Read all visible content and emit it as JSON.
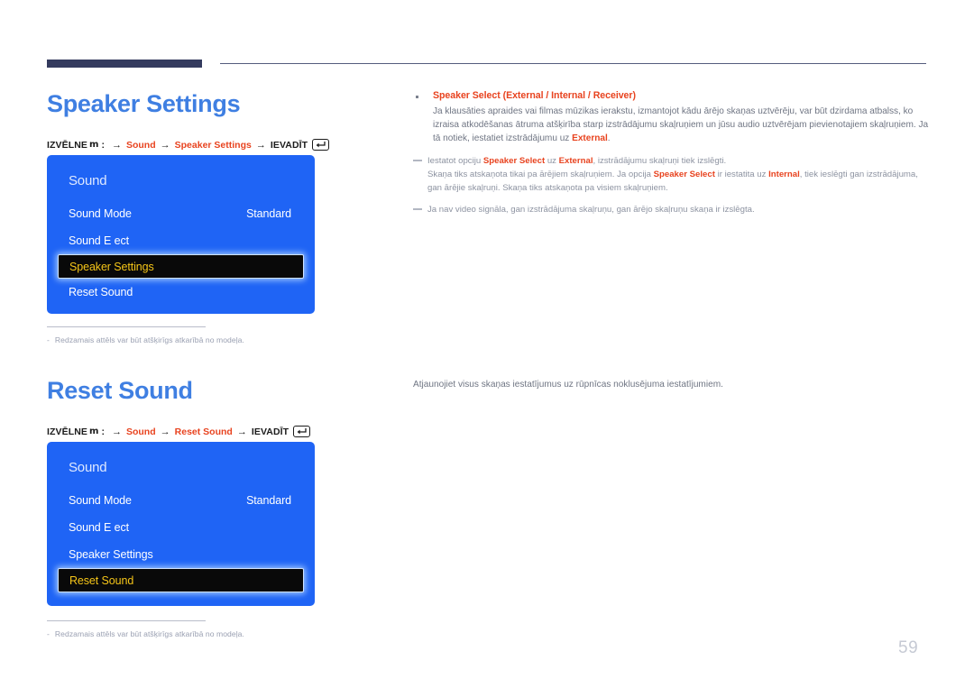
{
  "document": {
    "page_number": "59",
    "accent_blue": "#3f7fe2",
    "osd_blue": "#1f64f5",
    "accent_red": "#e8431f",
    "highlight_yellow": "#f5c518",
    "rule_navy": "#343b5e"
  },
  "sections": [
    {
      "heading": "Speaker Settings",
      "breadcrumb": {
        "menu_label": "IZVĒLNE",
        "menu_glyph": "m",
        "colon": ":",
        "arrow": "→",
        "path": [
          "Sound",
          "Speaker Settings"
        ],
        "enter_label": "IEVADĪT",
        "enter_icon": "enter-key-icon"
      },
      "osd": {
        "title": "Sound",
        "rows": [
          {
            "name": "Sound Mode",
            "value": "Standard",
            "selected": false
          },
          {
            "name": "Sound E ect",
            "value": "",
            "selected": false
          },
          {
            "name": "Speaker Settings",
            "value": "",
            "selected": true
          },
          {
            "name": "Reset Sound",
            "value": "",
            "selected": false
          }
        ]
      },
      "figure_note": {
        "dash": "-",
        "text": "Redzamais attēls var būt atšķirīgs atkarībā no modeļa."
      }
    },
    {
      "heading": "Reset Sound",
      "breadcrumb": {
        "menu_label": "IZVĒLNE",
        "menu_glyph": "m",
        "colon": ":",
        "arrow": "→",
        "path": [
          "Sound",
          "Reset Sound"
        ],
        "enter_label": "IEVADĪT",
        "enter_icon": "enter-key-icon"
      },
      "osd": {
        "title": "Sound",
        "rows": [
          {
            "name": "Sound Mode",
            "value": "Standard",
            "selected": false
          },
          {
            "name": "Sound E ect",
            "value": "",
            "selected": false
          },
          {
            "name": "Speaker Settings",
            "value": "",
            "selected": false
          },
          {
            "name": "Reset Sound",
            "value": "",
            "selected": true
          }
        ]
      },
      "figure_note": {
        "dash": "-",
        "text": "Redzamais attēls var būt atšķirīgs atkarībā no modeļa."
      }
    }
  ],
  "right_column": {
    "bullet": {
      "title_main": "Speaker Select",
      "title_options": "(External / Internal / Receiver)",
      "paragraph_html": "Ja klausāties apraides vai filmas mūzikas ierakstu, izmantojot kādu ārējo skaņas uztvērēju, var būt dzirdama atbalss, ko izraisa atkodēšanas ātruma atšķirība starp izstrādājumu skaļruņiem un jūsu audio uztvērējam pievienotajiem skaļruņiem. Ja tā notiek, iestatiet izstrādājumu uz <b>External</b>."
    },
    "notes": [
      {
        "html": "Iestatot opciju <b>Speaker Select</b> uz <b>External</b>, izstrādājumu skaļruņi tiek izslēgti.<br>Skaņa tiks atskaņota tikai pa ārējiem skaļruņiem. Ja opcija <b>Speaker Select</b> ir iestatita uz <b>Internal</b>, tiek ieslēgti gan izstrādājuma, gan ārējie skaļruņi. Skaņa tiks atskaņota pa visiem skaļruņiem."
      },
      {
        "html": "Ja nav video signāla, gan izstrādājuma skaļruņu, gan ārējo skaļruņu skaņa ir izslēgta."
      }
    ],
    "reset_sound_description": "Atjaunojiet visus skaņas iestatījumus uz rūpnīcas noklusējuma iestatījumiem."
  }
}
